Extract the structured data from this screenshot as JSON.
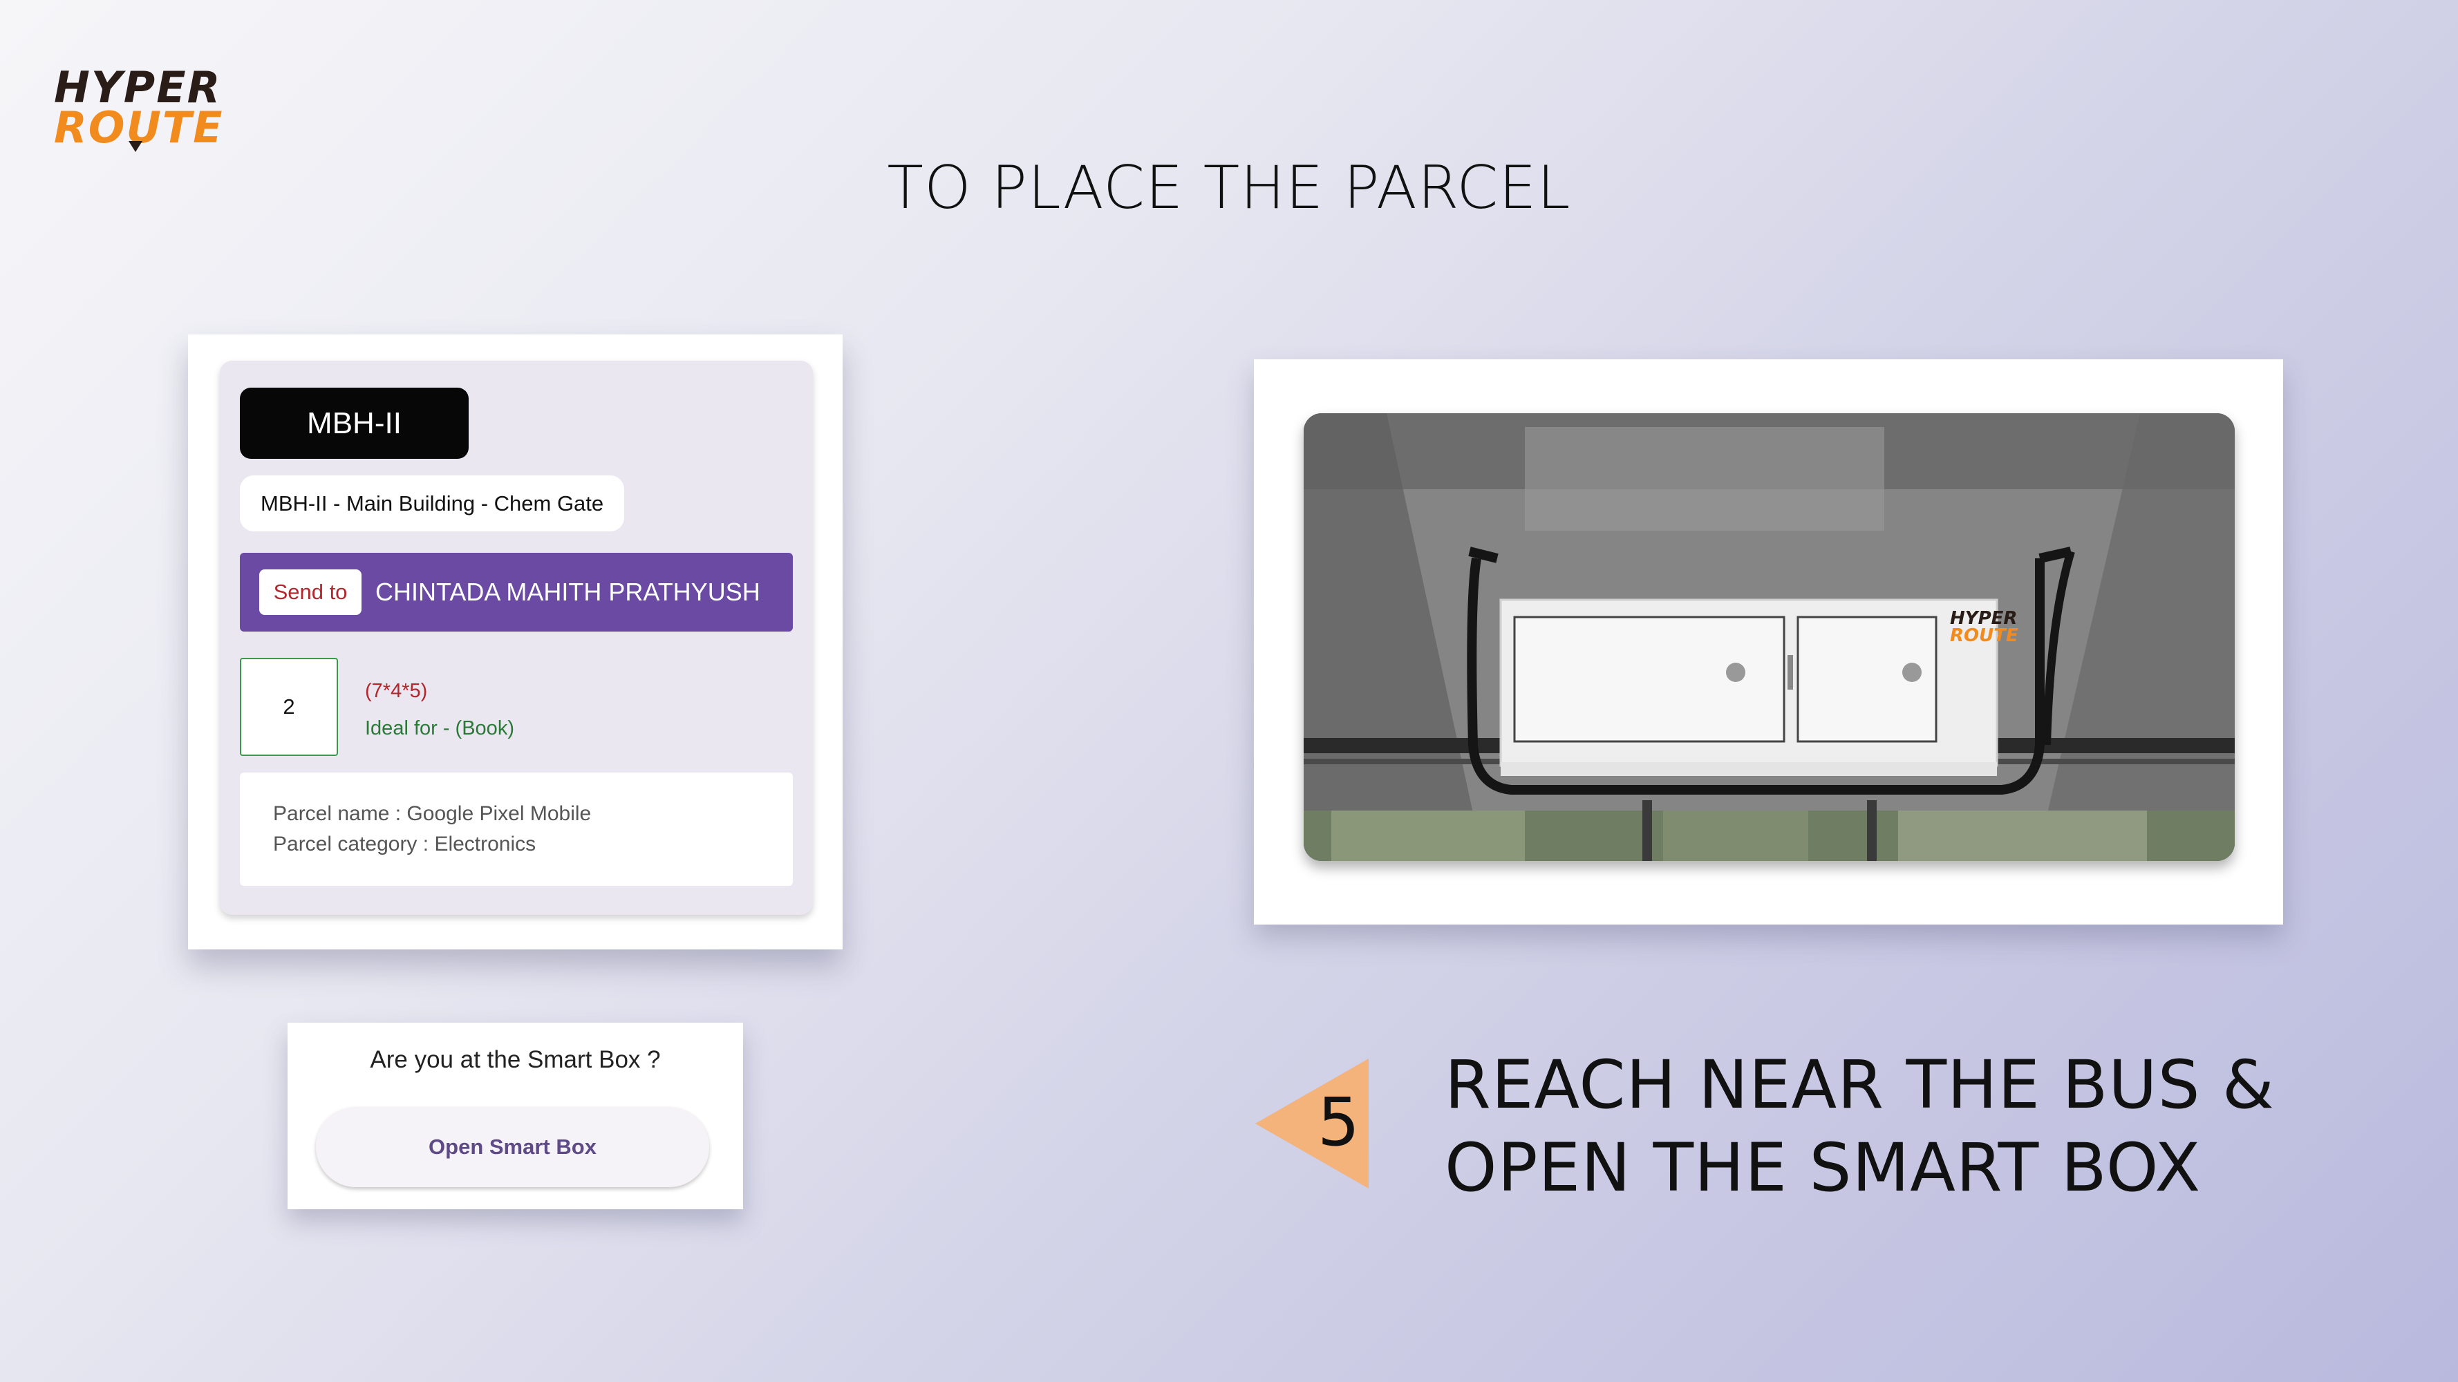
{
  "brand": {
    "line1": "HYPER",
    "line2": "ROUTE"
  },
  "page_title": "TO PLACE THE PARCEL",
  "card": {
    "stop_code": "MBH-II",
    "route": "MBH-II  - Main Building - Chem Gate",
    "send_to_label": "Send to",
    "recipient": "CHINTADA MAHITH PRATHYUSH",
    "quantity": "2",
    "dimensions": "(7*4*5)",
    "ideal_for": "Ideal for - (Book)",
    "parcel_name": "Parcel name : Google Pixel Mobile",
    "parcel_category": "Parcel category : Electronics"
  },
  "prompt": {
    "question": "Are you at the Smart Box ?",
    "button": "Open Smart Box"
  },
  "photo": {
    "box_brand_line1": "HYPER",
    "box_brand_line2": "ROUTE"
  },
  "step": {
    "number": "5",
    "line1": "REACH NEAR THE BUS &",
    "line2": "OPEN THE SMART BOX"
  },
  "colors": {
    "accent_purple": "#6a4aa3",
    "brand_orange": "#f28b1e",
    "step_arrow": "#f3b37b",
    "alert_red": "#b2262c",
    "success_green": "#2a7a37"
  }
}
